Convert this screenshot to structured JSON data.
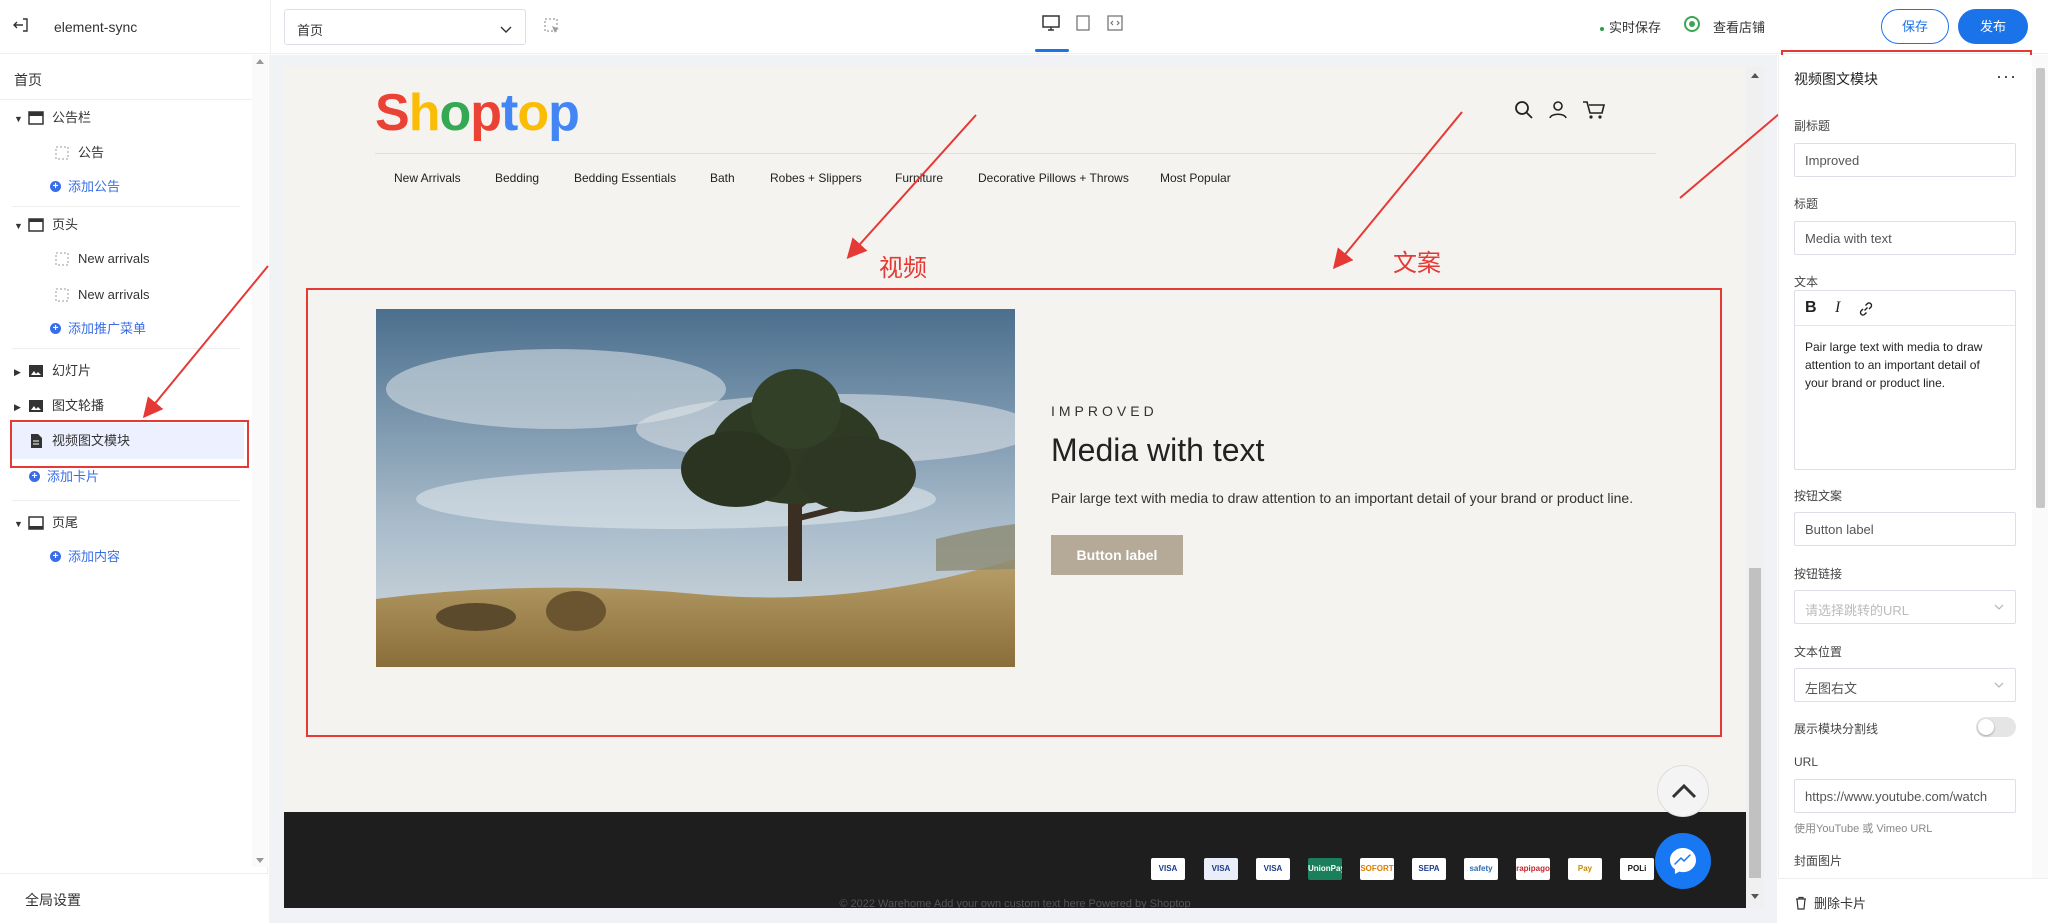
{
  "topbar": {
    "app_name": "element-sync",
    "page_select": "首页",
    "autosave": "实时保存",
    "view_store": "查看店铺",
    "save": "保存",
    "publish": "发布"
  },
  "sidebar": {
    "heading": "首页",
    "items": [
      {
        "label": "公告栏"
      },
      {
        "label": "公告"
      },
      {
        "label": "添加公告"
      },
      {
        "label": "页头"
      },
      {
        "label": "New arrivals"
      },
      {
        "label": "New arrivals"
      },
      {
        "label": "添加推广菜单"
      },
      {
        "label": "幻灯片"
      },
      {
        "label": "图文轮播"
      },
      {
        "label": "视频图文模块"
      },
      {
        "label": "添加卡片"
      },
      {
        "label": "页尾"
      },
      {
        "label": "添加内容"
      }
    ],
    "footer": "全局设置"
  },
  "preview": {
    "logo": "Shoptop",
    "nav": [
      "New Arrivals",
      "Bedding",
      "Bedding Essentials",
      "Bath",
      "Robes + Slippers",
      "Furniture",
      "Decorative Pillows + Throws",
      "Most Popular"
    ],
    "media": {
      "eyebrow": "IMPROVED",
      "title": "Media with text",
      "text": "Pair large text with media to draw attention to an important detail of your brand or product line.",
      "button": "Button label"
    },
    "payments": [
      "VISA",
      "VISA",
      "VISA",
      "UnionPay",
      "SOFORT",
      "SEPA",
      "safety",
      "rapipago",
      "Pay",
      "POLi"
    ],
    "copyright": "© 2022 Warehome Add your own custom text here Powered by Shoptop"
  },
  "annotations": {
    "video": "视频",
    "copy": "文案"
  },
  "panel": {
    "title": "视频图文模块",
    "subtitle_label": "副标题",
    "subtitle_value": "Improved",
    "title_label": "标题",
    "title_value": "Media with text",
    "text_label": "文本",
    "text_value": "Pair large text with media to draw attention to an important detail of your brand or product line.",
    "button_text_label": "按钮文案",
    "button_text_value": "Button label",
    "button_link_label": "按钮链接",
    "button_link_placeholder": "请选择跳转的URL",
    "text_position_label": "文本位置",
    "text_position_value": "左图右文",
    "divider_label": "展示模块分割线",
    "divider_on": false,
    "url_label": "URL",
    "url_value": "https://www.youtube.com/watch",
    "url_hint": "使用YouTube 或 Vimeo URL",
    "cover_label": "封面图片",
    "delete": "删除卡片"
  },
  "colors": {
    "primary": "#1a73e8",
    "annotation": "#e53935",
    "media_button": "#b5a998"
  }
}
